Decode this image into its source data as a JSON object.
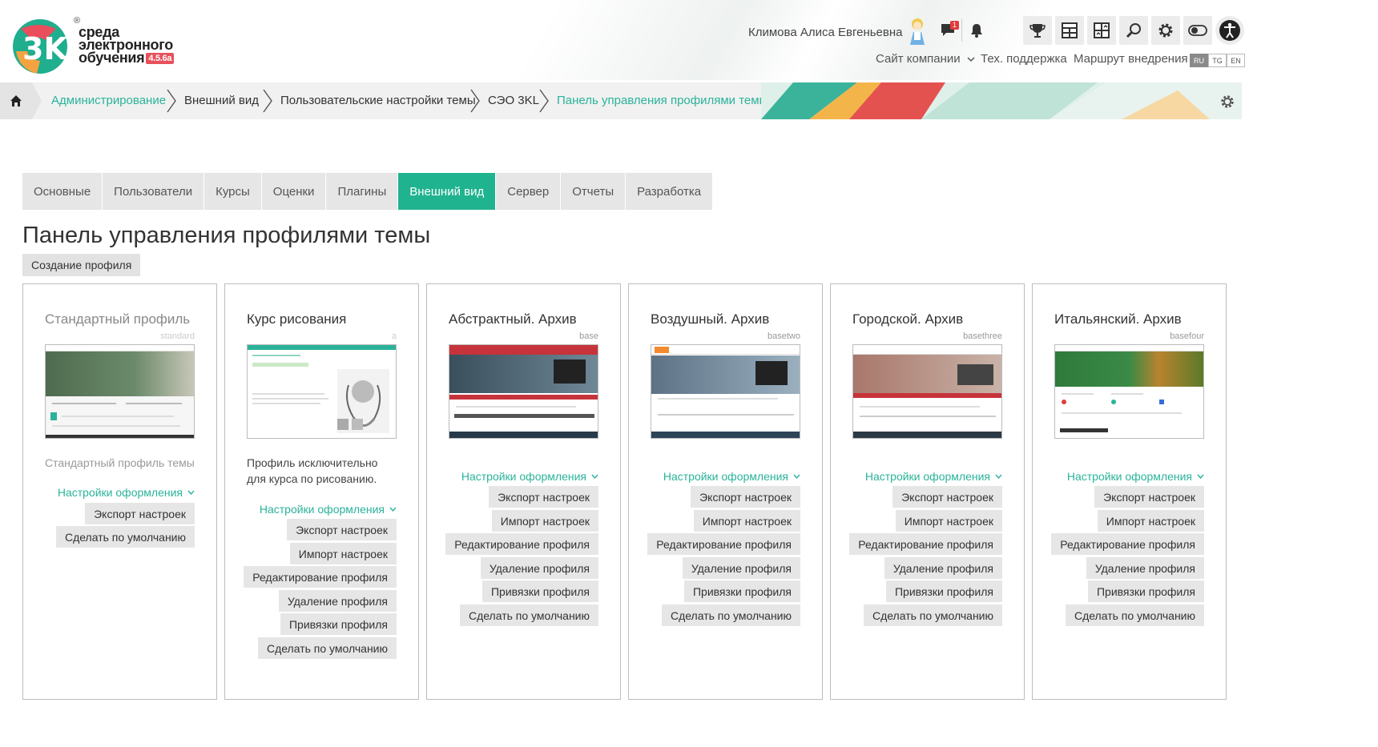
{
  "header": {
    "logo_text_lines": [
      "среда",
      "электронного",
      "обучения"
    ],
    "logo_version": "4.5.6a",
    "logo_mark": "3K",
    "logo_reg": "®",
    "user_name": "Климова Алиса Евгеньевна",
    "messages_count": "1",
    "icons": [
      "chat-icon",
      "bell-icon",
      "trophy-icon",
      "dashboard-icon",
      "blocks-icon",
      "search-icon",
      "gear-icon",
      "toggle-icon",
      "accessibility-icon"
    ],
    "links": {
      "company_site": "Сайт компании",
      "support": "Тех. поддержка",
      "route": "Маршрут внедрения"
    },
    "languages": [
      "RU",
      "TG",
      "EN"
    ],
    "active_language": "RU"
  },
  "breadcrumb": {
    "items": [
      "Администрирование",
      "Внешний вид",
      "Пользовательские настройки темы",
      "СЭО 3KL",
      "Панель управления профилями темы"
    ]
  },
  "tabs": [
    "Основные",
    "Пользователи",
    "Курсы",
    "Оценки",
    "Плагины",
    "Внешний вид",
    "Сервер",
    "Отчеты",
    "Разработка"
  ],
  "active_tab": "Внешний вид",
  "page": {
    "title": "Панель управления профилями темы",
    "create_button": "Создание профиля"
  },
  "cards": [
    {
      "title": "Стандартный профиль",
      "code": "standard",
      "description": "Стандартный профиль темы",
      "settings_label": "Настройки оформления",
      "actions": [
        "Экспорт настроек",
        "Сделать по умолчанию"
      ]
    },
    {
      "title": "Курс рисования",
      "code": "a",
      "description": "Профиль исключительно для курса по рисованию.",
      "settings_label": "Настройки оформления",
      "actions": [
        "Экспорт настроек",
        "Импорт настроек",
        "Редактирование профиля",
        "Удаление профиля",
        "Привязки профиля",
        "Сделать по умолчанию"
      ]
    },
    {
      "title": "Абстрактный. Архив",
      "code": "base",
      "description": "",
      "settings_label": "Настройки оформления",
      "actions": [
        "Экспорт настроек",
        "Импорт настроек",
        "Редактирование профиля",
        "Удаление профиля",
        "Привязки профиля",
        "Сделать по умолчанию"
      ]
    },
    {
      "title": "Воздушный. Архив",
      "code": "basetwo",
      "description": "",
      "settings_label": "Настройки оформления",
      "actions": [
        "Экспорт настроек",
        "Импорт настроек",
        "Редактирование профиля",
        "Удаление профиля",
        "Привязки профиля",
        "Сделать по умолчанию"
      ]
    },
    {
      "title": "Городской. Архив",
      "code": "basethree",
      "description": "",
      "settings_label": "Настройки оформления",
      "actions": [
        "Экспорт настроек",
        "Импорт настроек",
        "Редактирование профиля",
        "Удаление профиля",
        "Привязки профиля",
        "Сделать по умолчанию"
      ]
    },
    {
      "title": "Итальянский. Архив",
      "code": "basefour",
      "description": "",
      "settings_label": "Настройки оформления",
      "actions": [
        "Экспорт настроек",
        "Импорт настроек",
        "Редактирование профиля",
        "Удаление профиля",
        "Привязки профиля",
        "Сделать по умолчанию"
      ]
    }
  ],
  "colors": {
    "accent": "#20b38f",
    "link": "#2ab39a",
    "badge": "#e23a3a",
    "button_bg": "#e6e6e6"
  }
}
